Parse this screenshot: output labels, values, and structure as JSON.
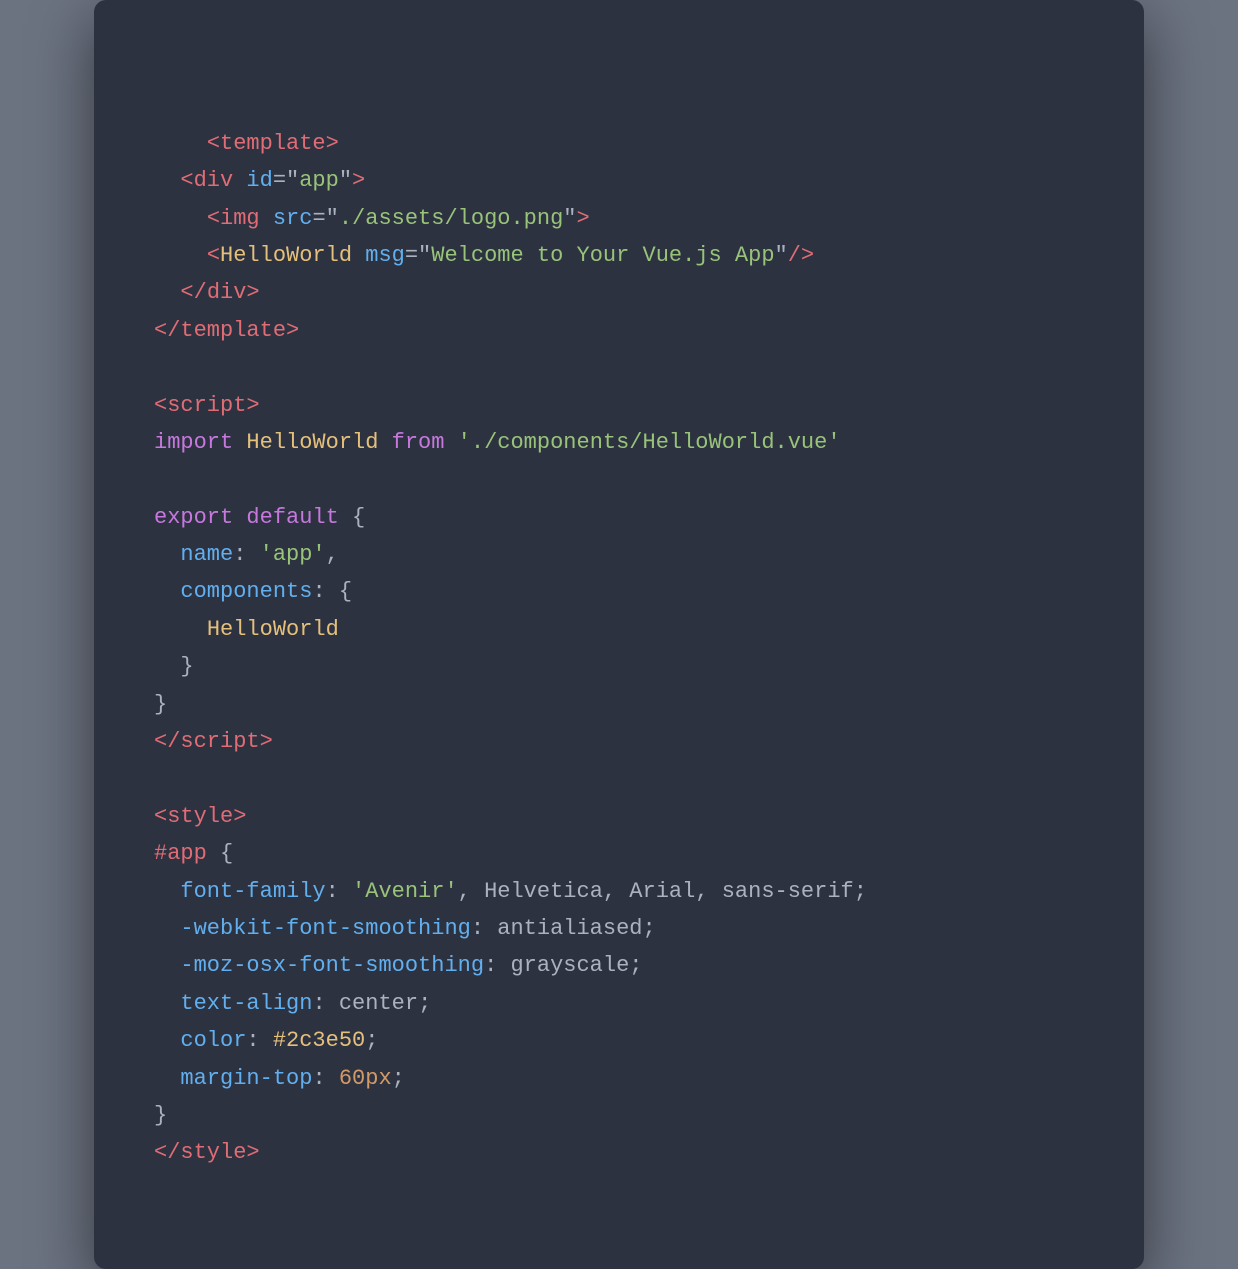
{
  "window": {
    "background": "#2d3241"
  },
  "code": {
    "lines": [
      "<template>",
      "  <div id=\"app\">",
      "    <img src=\"./assets/logo.png\">",
      "    <HelloWorld msg=\"Welcome to Your Vue.js App\"/>",
      "  </div>",
      "</template>",
      "",
      "<script>",
      "import HelloWorld from './components/HelloWorld.vue'",
      "",
      "export default {",
      "  name: 'app',",
      "  components: {",
      "    HelloWorld",
      "  }",
      "}",
      "</script>",
      "",
      "<style>",
      "#app {",
      "  font-family: 'Avenir', Helvetica, Arial, sans-serif;",
      "  -webkit-font-smoothing: antialiased;",
      "  -moz-osx-font-smoothing: grayscale;",
      "  text-align: center;",
      "  color: #2c3e50;",
      "  margin-top: 60px;",
      "}",
      "</style>"
    ]
  }
}
